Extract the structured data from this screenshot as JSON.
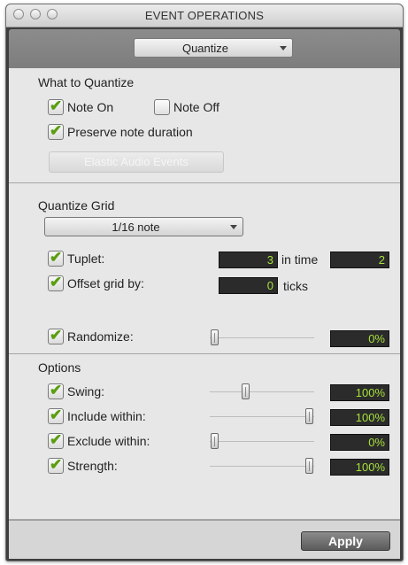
{
  "window": {
    "title": "EVENT OPERATIONS"
  },
  "operation_popup": {
    "value": "Quantize"
  },
  "what_to_quantize": {
    "title": "What to Quantize",
    "note_on": {
      "label": "Note On",
      "checked": true
    },
    "note_off": {
      "label": "Note Off",
      "checked": false
    },
    "preserve_duration": {
      "label": "Preserve note duration",
      "checked": true
    },
    "elastic_audio_button": {
      "label": "Elastic Audio Events",
      "enabled": false
    }
  },
  "quantize_grid": {
    "title": "Quantize Grid",
    "grid_popup": {
      "value": "1/16 note"
    },
    "tuplet": {
      "label": "Tuplet:",
      "checked": true,
      "value": "3",
      "in_time_label": "in time",
      "in_time_value": "2"
    },
    "offset": {
      "label": "Offset grid by:",
      "checked": true,
      "value": "0",
      "unit_label": "ticks"
    },
    "randomize": {
      "label": "Randomize:",
      "checked": true,
      "value": "0%",
      "level": 0
    }
  },
  "options": {
    "title": "Options",
    "swing": {
      "label": "Swing:",
      "checked": true,
      "value": "100%",
      "level": 0.33
    },
    "include_within": {
      "label": "Include within:",
      "checked": true,
      "value": "100%",
      "level": 1.0
    },
    "exclude_within": {
      "label": "Exclude within:",
      "checked": true,
      "value": "0%",
      "level": 0
    },
    "strength": {
      "label": "Strength:",
      "checked": true,
      "value": "100%",
      "level": 1.0
    }
  },
  "apply_button": {
    "label": "Apply"
  },
  "colors": {
    "checkmark": "#5a9e0f",
    "readout_text": "#a6e23a",
    "readout_bg": "#2b2b2b"
  },
  "icons": {
    "checkbox_checked": "checkmark-icon",
    "popup": "chevron-down-icon"
  }
}
